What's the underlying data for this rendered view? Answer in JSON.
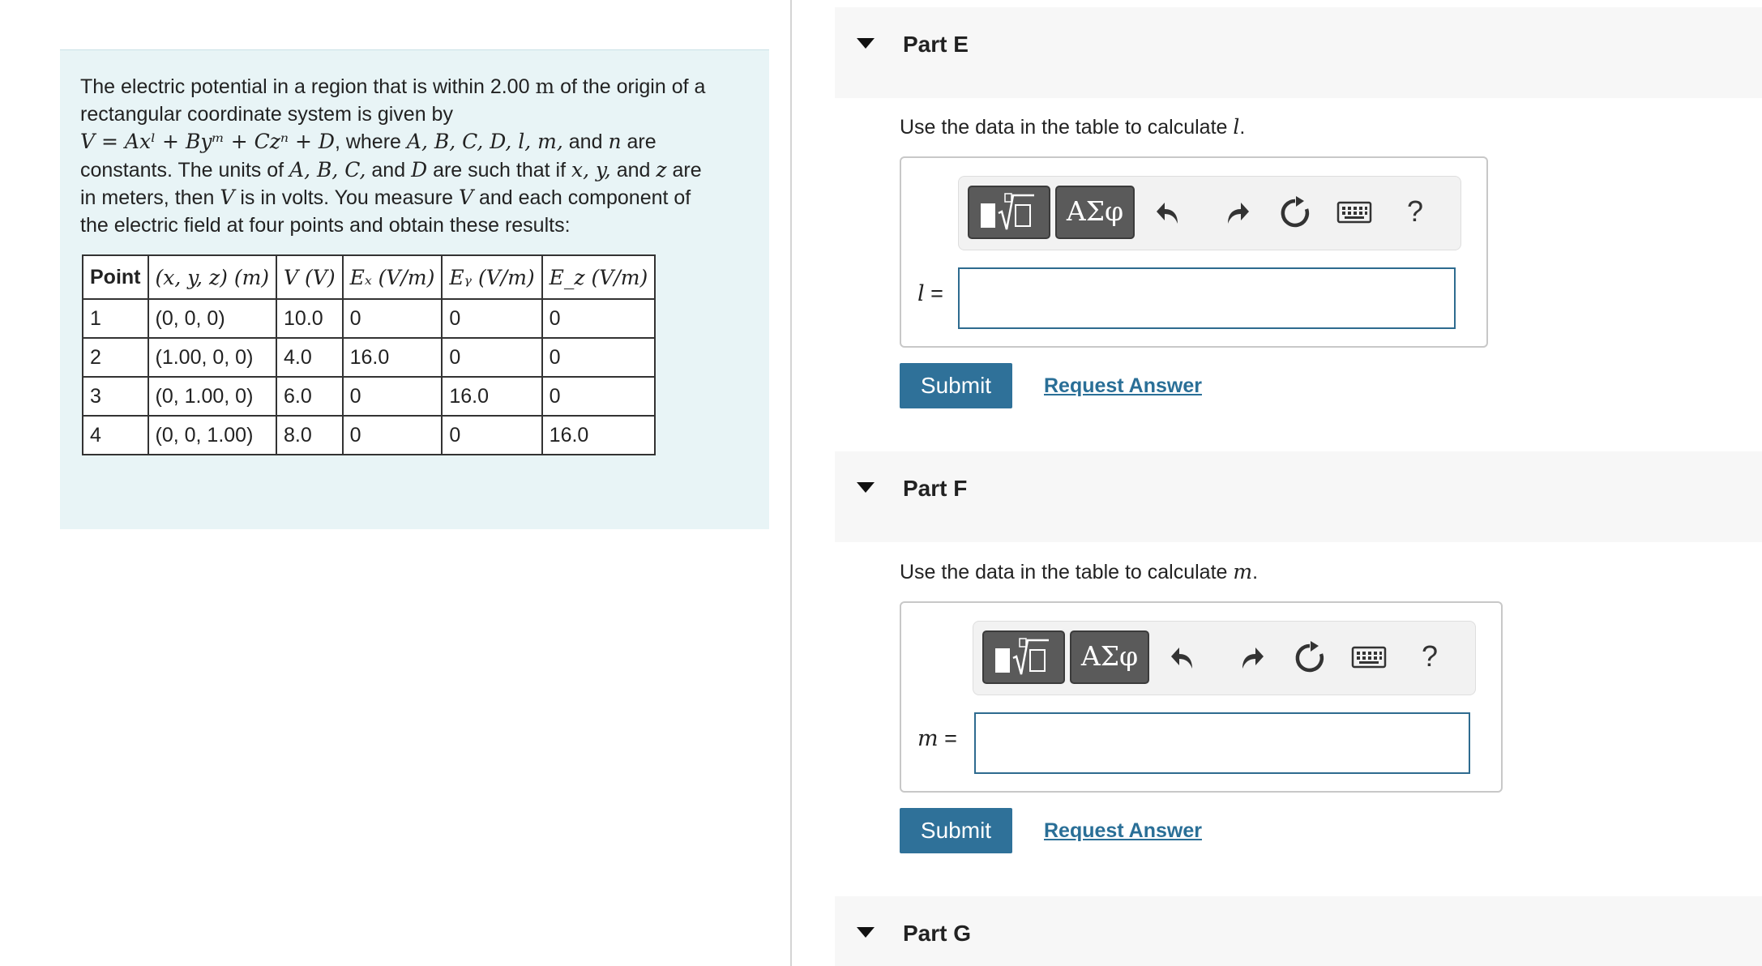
{
  "problem": {
    "line1": "The electric potential in a region that is within 2.00",
    "unit_m": "m",
    "line1_end": "of the origin of a",
    "line2": "rectangular coordinate system is given by",
    "equation": "V = Axˡ + Byᵐ + Czⁿ + D",
    "where_text": ", where",
    "constants_list": "A, B, C, D, l, m,",
    "and_word": "and",
    "n_var": "n",
    "are_word": "are",
    "line4_a": "constants. The units of",
    "abc_list": "A, B, C,",
    "line4_b": "and",
    "d_var": "D",
    "line4_c": "are such that if",
    "xyz_list": "x, y,",
    "line4_d": "and",
    "z_var": "z",
    "line4_e": "are",
    "line5_a": "in meters, then",
    "v_var": "V",
    "line5_b": "is in volts. You measure",
    "v_var2": "V",
    "line5_c": "and each component of",
    "line6": "the electric field at four points and obtain these results:"
  },
  "table": {
    "headers": [
      "Point",
      "(x, y, z) (m)",
      "V (V)",
      "Eₓ (V/m)",
      "Eᵧ (V/m)",
      "E_z (V/m)"
    ],
    "rows": [
      [
        "1",
        "(0, 0, 0)",
        "10.0",
        "0",
        "0",
        "0"
      ],
      [
        "2",
        "(1.00, 0, 0)",
        "4.0",
        "16.0",
        "0",
        "0"
      ],
      [
        "3",
        "(0, 1.00, 0)",
        "6.0",
        "0",
        "16.0",
        "0"
      ],
      [
        "4",
        "(0, 0, 1.00)",
        "8.0",
        "0",
        "0",
        "16.0"
      ]
    ]
  },
  "parts": {
    "e": {
      "title": "Part E",
      "prompt": "Use the data in the table to calculate",
      "prompt_var": "l",
      "var_label": "l",
      "equals": "=",
      "input_value": "",
      "submit_label": "Submit",
      "request_label": "Request Answer"
    },
    "f": {
      "title": "Part F",
      "prompt": "Use the data in the table to calculate",
      "prompt_var": "m",
      "var_label": "m",
      "equals": "=",
      "input_value": "",
      "submit_label": "Submit",
      "request_label": "Request Answer"
    },
    "g": {
      "title": "Part G"
    }
  },
  "toolbar": {
    "greek_label": "ΑΣφ",
    "help_label": "?",
    "icons": [
      "templates-icon",
      "greek-symbols-icon",
      "undo-icon",
      "redo-icon",
      "reset-icon",
      "keyboard-icon",
      "help-icon"
    ]
  },
  "colors": {
    "panel_bg": "#e8f4f6",
    "submit_bg": "#2f7199",
    "link": "#2a6f97",
    "input_border": "#2e6b8f"
  }
}
